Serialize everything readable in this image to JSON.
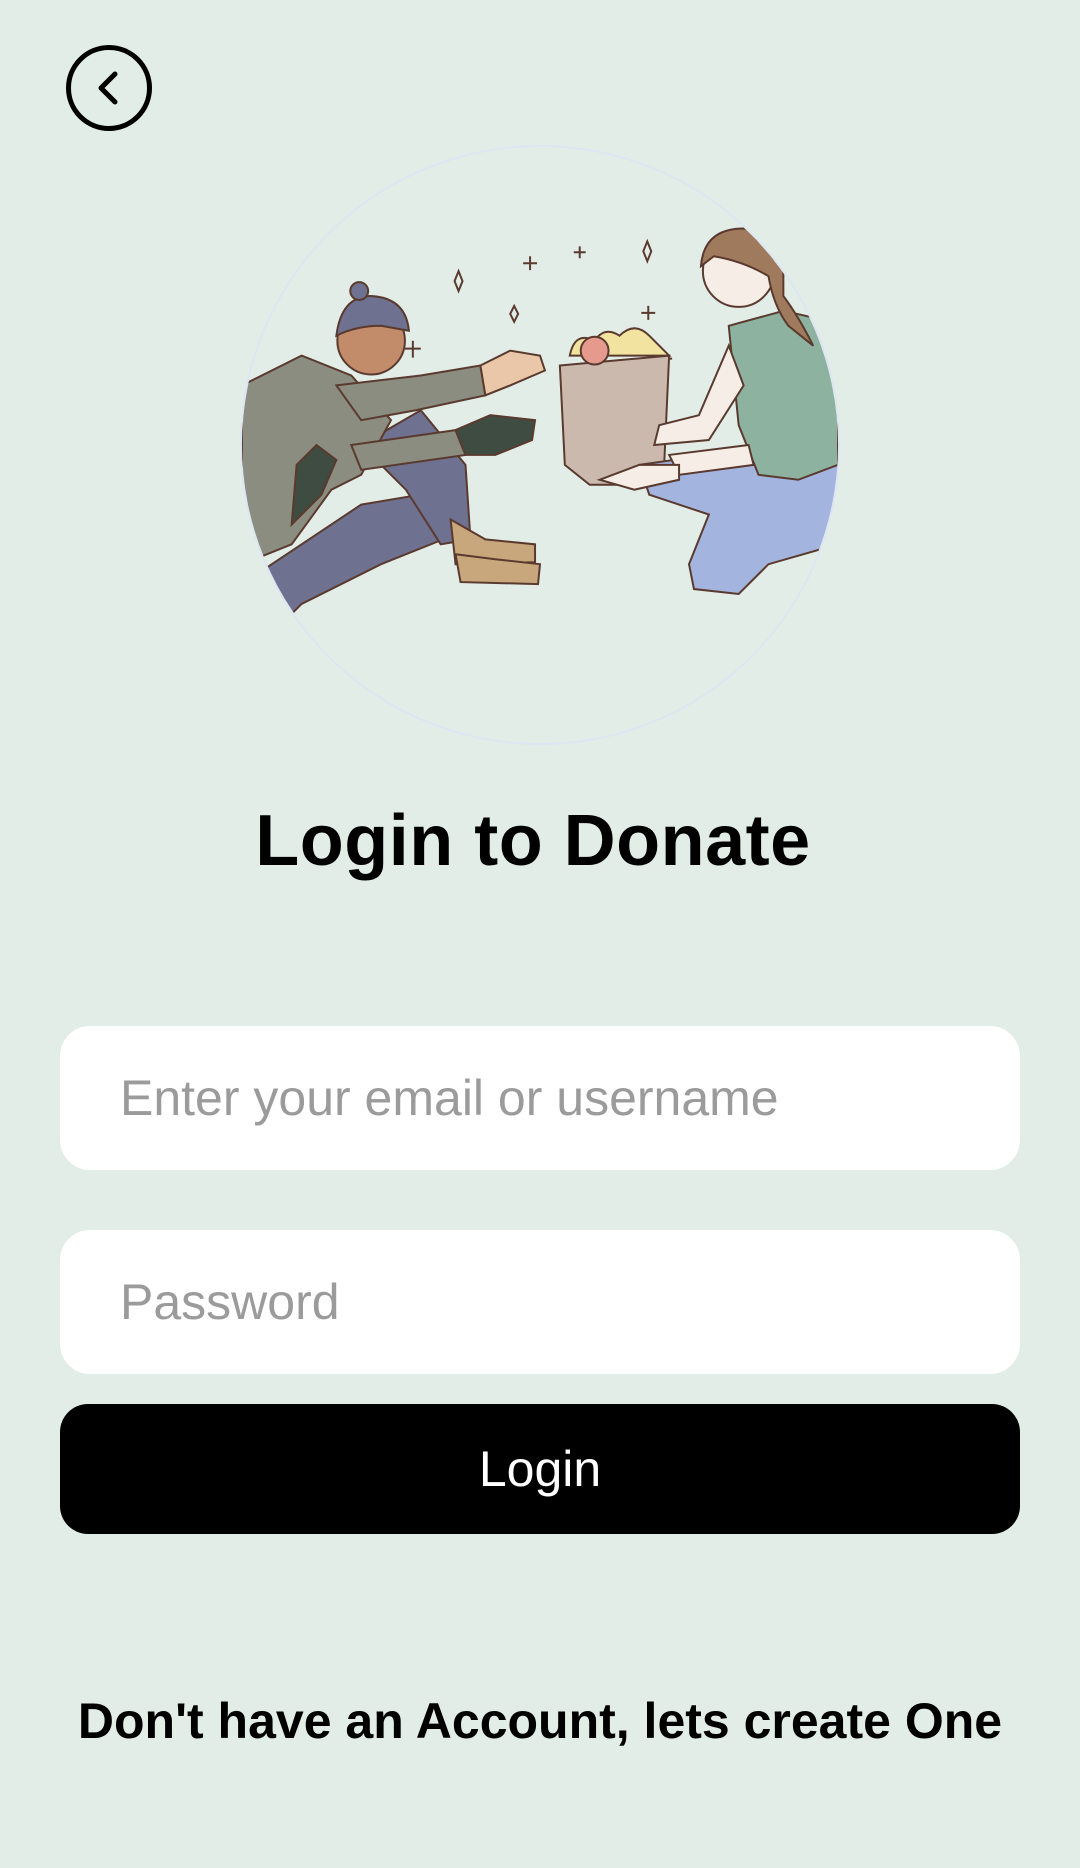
{
  "header": {
    "back_icon": "chevron-left-icon"
  },
  "hero": {
    "illustration": "donation-illustration"
  },
  "page": {
    "title": "Login to Donate"
  },
  "form": {
    "email_placeholder": "Enter your email or username",
    "email_value": "",
    "password_placeholder": "Password",
    "password_value": "",
    "login_label": "Login"
  },
  "footer": {
    "signup_text": "Don't have an Account, lets create One"
  },
  "colors": {
    "background": "#e2ede7",
    "button": "#000000",
    "input_bg": "#ffffff",
    "placeholder": "#9b9b9b"
  }
}
